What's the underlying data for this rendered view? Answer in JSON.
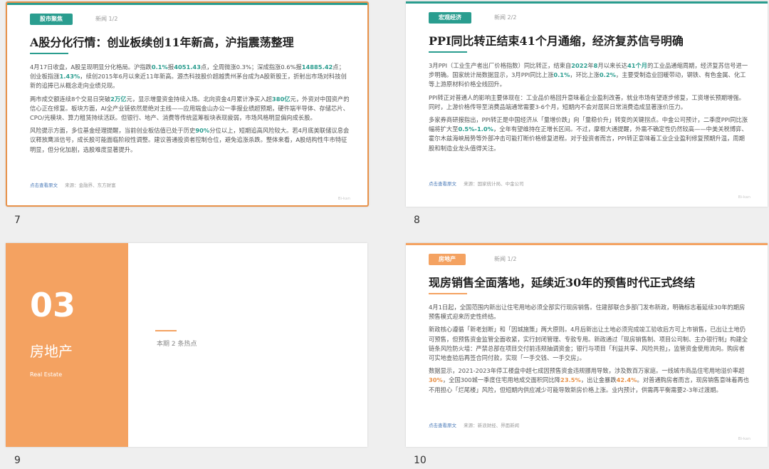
{
  "colors": {
    "teal": "#2a9d8f",
    "orange": "#f4a261",
    "selection": "#e8924a"
  },
  "slides": [
    {
      "num": "7",
      "tag": "股市聚焦",
      "page": "新闻 1/2",
      "title": "A股分化行情：创业板续创11年新高，沪指震荡整理",
      "paragraphs": [
        [
          "4月17日收盘，A股呈现明显分化格局。沪指跌",
          "0.1%",
          "报",
          "4051.43",
          "点，全周微涨0.3%；深成指涨0.6%报",
          "14885.42",
          "点；创业板指涨",
          "1.43%",
          "，续创2015年6月以来近11年新高。源杰科技股价超越贵州茅台成为A股新股王，折射出市场对科技创新的追捧已从概念走向业绩兑现。"
        ],
        [
          "两市成交额连续8个交易日突破",
          "2万亿",
          "元，显示增量资金持续入场。北向资金4月累计净买入超",
          "380亿",
          "元，外资对中国资产的信心正在修复。板块方面，AI全产业链依然是绝对主线——应用端金山办公一季报业绩超预期，硬件端半导体、存储芯片、CPO/光模块、算力租赁持续活跃。但银行、地产、消费等传统蓝筹板块表现疲弱，市场风格明显偏向成长股。"
        ],
        [
          "风险提示方面，多位基金经理提醒，当前创业板估值已处于历史",
          "90%",
          "分位以上，短期追高风险较大。若4月底美联储议息会议释放鹰派信号，成长股可能面临阶段性调整。建议普通投资者控制仓位，避免追涨杀跌。整体来看，A股结构性牛市特征明显，但分化加剧，选股难度显著提升。"
        ]
      ],
      "link": "点击查看原文",
      "source": "来源：金融界、东方财富",
      "corner": "Bi-kan"
    },
    {
      "num": "8",
      "tag": "宏观经济",
      "page": "新闻 2/2",
      "title": "PPI同比转正结束41个月通缩，经济复苏信号明确",
      "paragraphs": [
        [
          "3月PPI（工业生产者出厂价格指数）同比转正，结束自",
          "2022",
          "年",
          "8",
          "月以来长达",
          "41个月",
          "的工业品通缩周期，经济复苏信号进一步明确。国家统计局数据显示，3月PPI同比上涨",
          "0.1%",
          "，环比上涨",
          "0.2%",
          "，主要受制造业回暖带动，钢铁、有色金属、化工等上游原材料价格全线回升。"
        ],
        [
          "PPI转正对普通人的影响主要体现在：工业品价格回升意味着企业盈利改善，就业市场有望逐步修复，工资增长预期增强。同时，上游价格传导至消费品端通常需要3-6个月，短期内不会对居民日常消费造成显著涨价压力。"
        ],
        [
          "多家券商研报指出，PPI转正是中国经济从「量增价跌」向「量稳价升」转变的关键拐点。中金公司预计，二季度PPI同比涨幅将扩大至",
          "0.5%-1.0%",
          "，全年有望维持在正增长区间。不过，摩根大通提醒，外需不确定性仍然较高——中美关税博弈、霍尔木兹海峡局势等外部冲击可能打断价格修复进程。对于投资者而言，PPI转正意味着工业企业盈利修复预期升温，周期股和制造业龙头值得关注。"
        ]
      ],
      "link": "点击查看原文",
      "source": "来源：国家统计局、中金公司",
      "corner": "Bi-kan"
    },
    {
      "num": "9",
      "section_number": "03",
      "section_title": "房地产",
      "section_en": "Real Estate",
      "section_count": "本期 2 条热点"
    },
    {
      "num": "10",
      "tag": "房地产",
      "page": "新闻 1/2",
      "title": "现房销售全面落地，延续近30年的预售时代正式终结",
      "paragraphs": [
        [
          "4月1日起，全国范围内新出让住宅用地必须全部实行现房销售。住建部联合多部门发布新政，明确标志着延续30年的期房预售模式迎来历史性终结。"
        ],
        [
          "新政核心遵循「新老划断」和「因城施策」两大原则。4月后新出让土地必须完成竣工验收后方可上市销售，已出让土地仍可预售，但预售资金监管全面收紧，实行封闭管理、专款专用。新政通过「现房销售制、项目公司制、主办银行制」构建全链条风险防火墙：严禁总部在项目交付前违规抽调资金；银行与项目「利益共享、风险共担」，监管资金使用流向。购房者可实地查验后再签合同付款，实现「一手交钱、一手交房」。"
        ],
        [
          "数据显示，2021-2023年停工楼盘中超七成因预售资金违规挪用导致，涉及数百万家庭。一线城市商品住宅用地溢价率超",
          "30%",
          "，全国300城一季度住宅用地成交面积同比降",
          "23.5%",
          "，出让金暴跌",
          "42.4%",
          "。对普通购房者而言，现房销售意味着再也不用担心「烂尾楼」风险，但短期内供应减少可能导致新房价格上涨。业内预计，供需再平衡需要2-3年过渡期。"
        ]
      ],
      "link": "点击查看原文",
      "source": "来源：新浪财经、界面新闻",
      "corner": "Bi-kan"
    }
  ]
}
